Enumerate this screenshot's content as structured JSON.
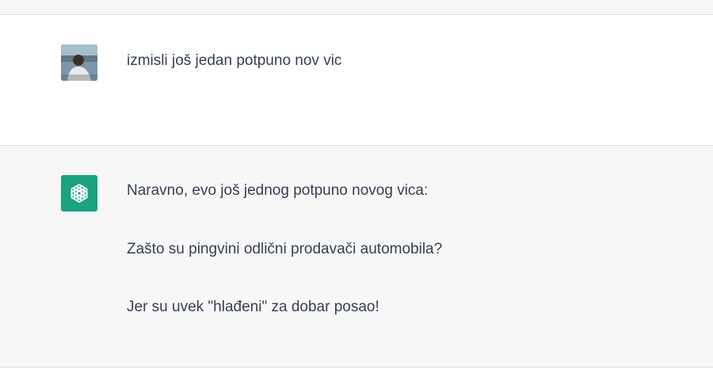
{
  "conversation": {
    "user_message": {
      "text": "izmisli još jedan potpuno nov vic"
    },
    "assistant_message": {
      "paragraphs": [
        "Naravno, evo još jednog potpuno novog vica:",
        "Zašto su pingvini odlični prodavači automobila?",
        "Jer su uvek \"hlađeni\" za dobar posao!"
      ]
    }
  },
  "icons": {
    "user_avatar": "user-avatar-photo",
    "assistant_avatar": "openai-logo-icon"
  },
  "colors": {
    "assistant_avatar_bg": "#19a37f",
    "user_row_bg": "#ffffff",
    "assistant_row_bg": "#f7f7f8",
    "text": "#374151"
  }
}
